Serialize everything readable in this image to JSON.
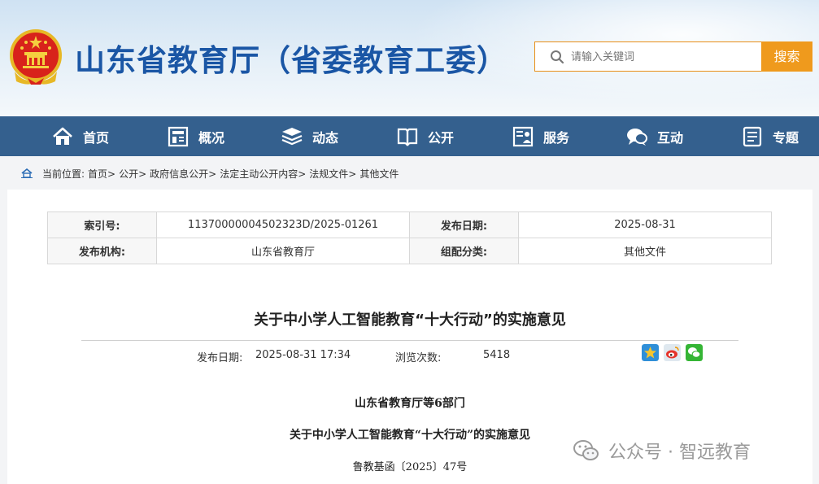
{
  "header": {
    "site_title": "山东省教育厅（省委教育工委）",
    "search": {
      "placeholder": "请输入关键词",
      "button_label": "搜索"
    }
  },
  "nav": {
    "items": [
      {
        "label": "首页",
        "icon": "home-icon"
      },
      {
        "label": "概况",
        "icon": "building-icon"
      },
      {
        "label": "动态",
        "icon": "stack-icon"
      },
      {
        "label": "公开",
        "icon": "book-icon"
      },
      {
        "label": "服务",
        "icon": "service-icon"
      },
      {
        "label": "互动",
        "icon": "chat-icon"
      },
      {
        "label": "专题",
        "icon": "document-icon"
      }
    ]
  },
  "breadcrumb": {
    "prefix": "当前位置:",
    "items": [
      "首页>",
      "公开>",
      "政府信息公开>",
      "法定主动公开内容>",
      "法规文件>",
      "其他文件"
    ]
  },
  "meta_table": {
    "rows": [
      {
        "k1": "索引号:",
        "v1": "11370000004502323D/2025-01261",
        "k2": "发布日期:",
        "v2": "2025-08-31"
      },
      {
        "k1": "发布机构:",
        "v1": "山东省教育厅",
        "k2": "组配分类:",
        "v2": "其他文件"
      }
    ]
  },
  "article": {
    "title": "关于中小学人工智能教育“十大行动”的实施意见",
    "pub_label": "发布日期:",
    "pub_value": "2025-08-31 17:34",
    "views_label": "浏览次数:",
    "views_value": "5418",
    "share_icons": [
      "qzone-icon",
      "weibo-icon",
      "wechat-icon"
    ],
    "issuer": "山东省教育厅等6部门",
    "body_title": "关于中小学人工智能教育“十大行动”的实施意见",
    "doc_number": "鲁教基函〔2025〕47号"
  },
  "watermark": {
    "text": "公众号 · 智远教育"
  },
  "colors": {
    "brand_blue": "#1a56a5",
    "nav_bg": "#34608e",
    "search_orange": "#ef9a1d"
  }
}
